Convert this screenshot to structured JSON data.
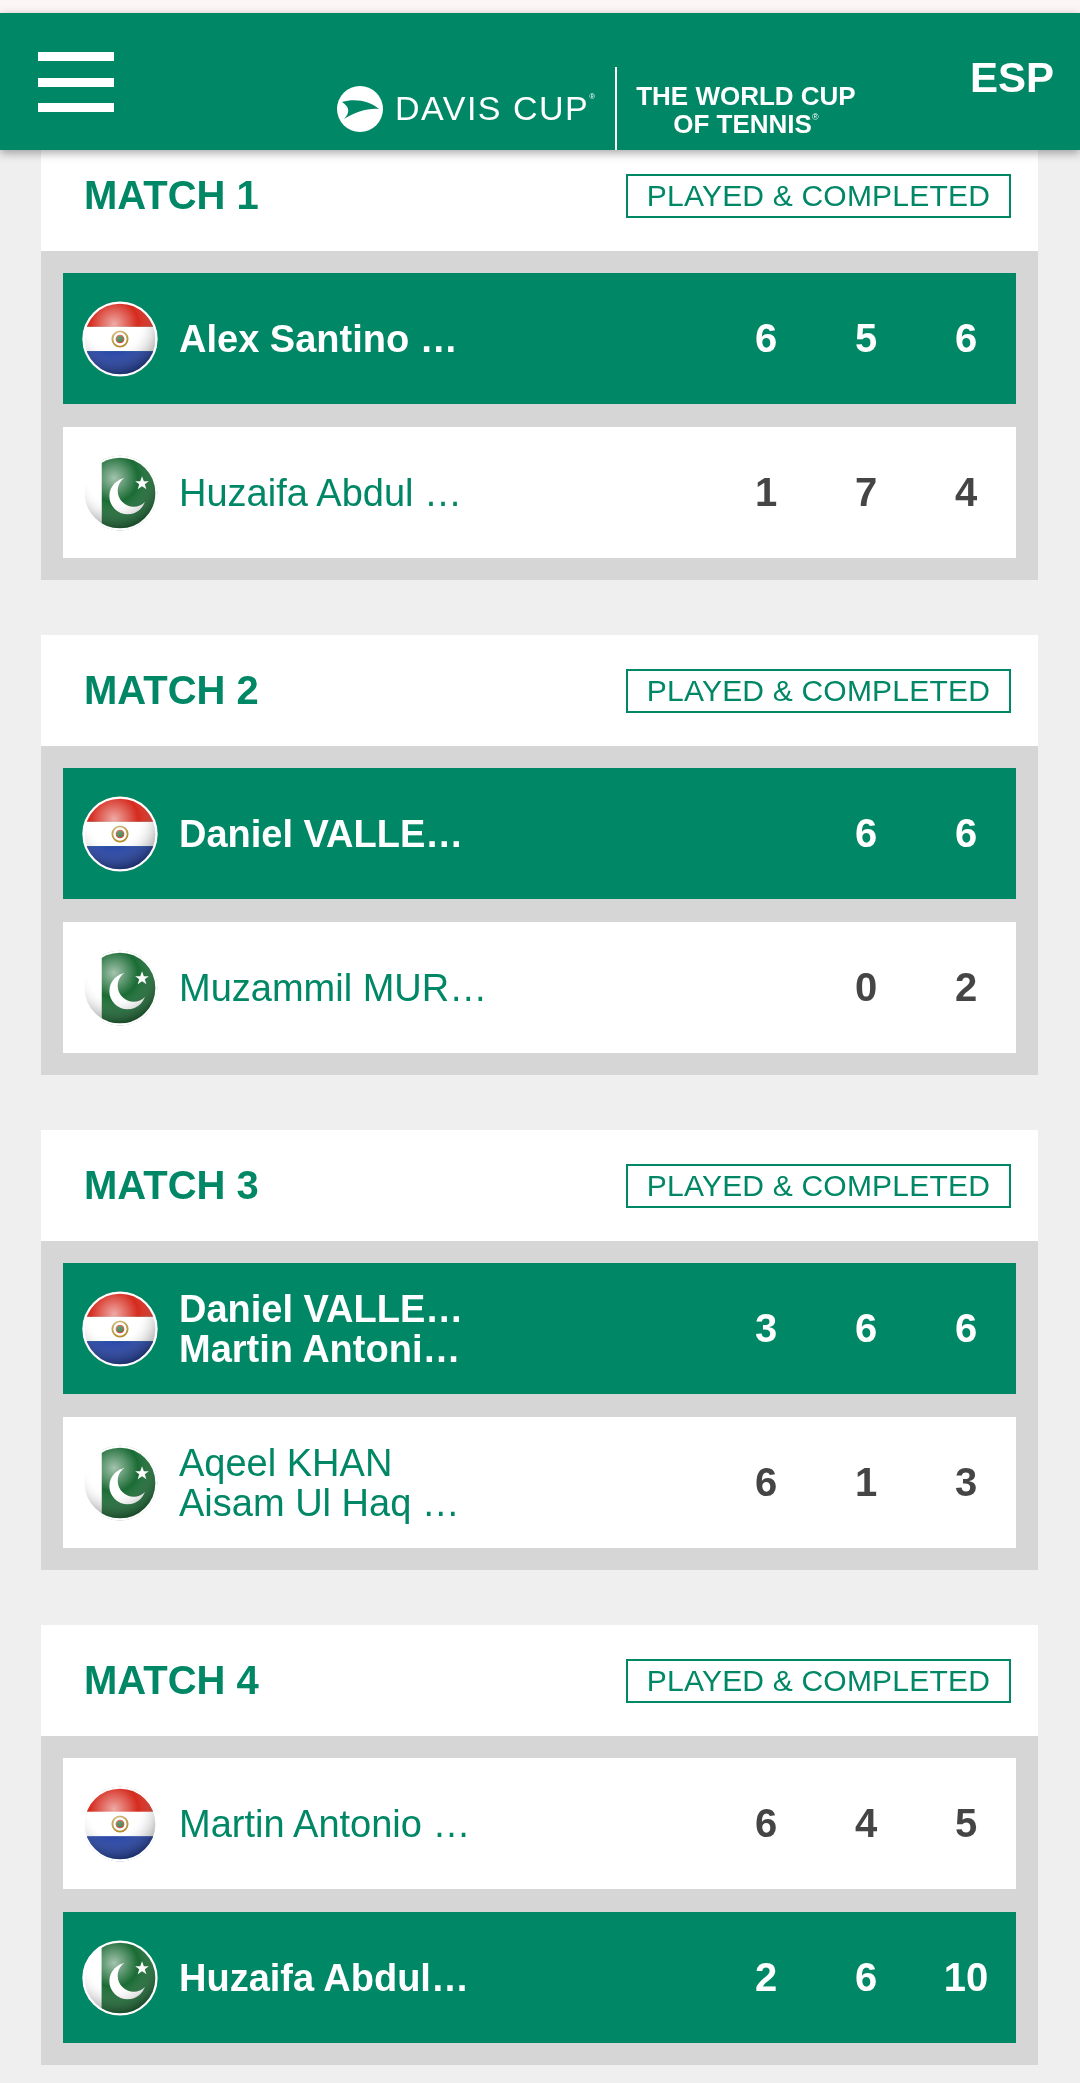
{
  "header": {
    "logo": {
      "name": "DAVIS CUP$^{®}$",
      "tagline": [
        "THE WORLD CUP",
        "OF TENNIS$^{®}$"
      ]
    },
    "language": "ESP"
  },
  "matches": [
    {
      "title": "MATCH 1",
      "status": "PLAYED & COMPLETED",
      "rows": [
        {
          "kind": "paraguay",
          "winner": true,
          "players": [
            "Alex Santino …"
          ],
          "scores": [
            "6",
            "5",
            "6"
          ]
        },
        {
          "kind": "pakistan",
          "winner": false,
          "players": [
            "Huzaifa Abdul …"
          ],
          "scores": [
            "1",
            "7",
            "4"
          ]
        }
      ]
    },
    {
      "title": "MATCH 2",
      "status": "PLAYED & COMPLETED",
      "rows": [
        {
          "kind": "paraguay",
          "winner": true,
          "players": [
            "Daniel VALLE…"
          ],
          "scores": [
            "6",
            "6"
          ]
        },
        {
          "kind": "pakistan",
          "winner": false,
          "players": [
            "Muzammil MUR…"
          ],
          "scores": [
            "0",
            "2"
          ]
        }
      ]
    },
    {
      "title": "MATCH 3",
      "status": "PLAYED & COMPLETED",
      "rows": [
        {
          "kind": "paraguay",
          "winner": true,
          "players": [
            "Daniel VALLE…",
            "Martin Antoni…"
          ],
          "scores": [
            "3",
            "6",
            "6"
          ]
        },
        {
          "kind": "pakistan",
          "winner": false,
          "players": [
            "Aqeel KHAN",
            "Aisam Ul Haq …"
          ],
          "scores": [
            "6",
            "1",
            "3"
          ]
        }
      ]
    },
    {
      "title": "MATCH 4",
      "status": "PLAYED & COMPLETED",
      "rows": [
        {
          "kind": "paraguay",
          "winner": false,
          "players": [
            "Martin Antonio …"
          ],
          "scores": [
            "6",
            "4",
            "5"
          ]
        },
        {
          "kind": "pakistan",
          "winner": true,
          "players": [
            "Huzaifa Abdul…"
          ],
          "scores": [
            "2",
            "6",
            "10"
          ]
        }
      ]
    }
  ]
}
